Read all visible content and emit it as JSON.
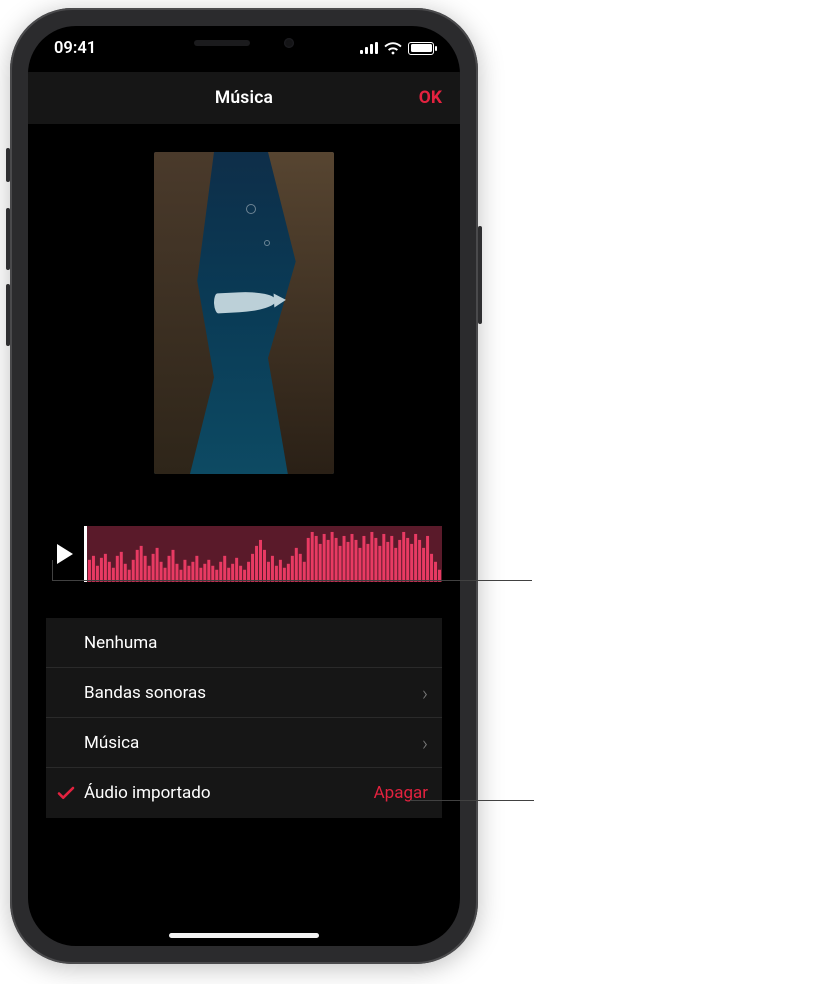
{
  "status": {
    "time": "09:41"
  },
  "navbar": {
    "title": "Música",
    "done": "OK"
  },
  "options": {
    "none": {
      "label": "Nenhuma"
    },
    "tracks": {
      "label": "Bandas sonoras"
    },
    "music": {
      "label": "Música"
    },
    "imported": {
      "label": "Áudio importado",
      "delete": "Apagar"
    }
  },
  "colors": {
    "accent": "#e3223f"
  }
}
